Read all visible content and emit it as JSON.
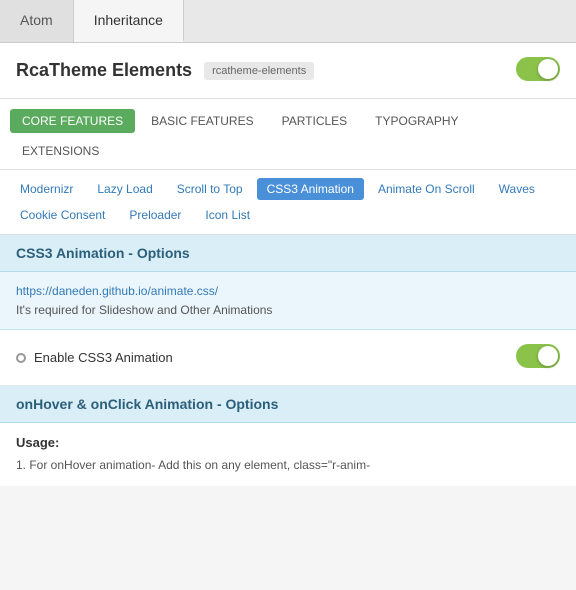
{
  "topTabs": [
    {
      "label": "Atom",
      "active": false
    },
    {
      "label": "Inheritance",
      "active": true
    }
  ],
  "header": {
    "title": "RcaTheme Elements",
    "badge": "rcatheme-elements",
    "toggleOn": true
  },
  "featureTabs": [
    {
      "label": "CORE FEATURES",
      "active": true
    },
    {
      "label": "BASIC FEATURES",
      "active": false
    },
    {
      "label": "PARTICLES",
      "active": false
    },
    {
      "label": "TYPOGRAPHY",
      "active": false
    }
  ],
  "extensionsTab": "EXTENSIONS",
  "subNav": [
    {
      "label": "Modernizr",
      "active": false
    },
    {
      "label": "Lazy Load",
      "active": false
    },
    {
      "label": "Scroll to Top",
      "active": false
    },
    {
      "label": "CSS3 Animation",
      "active": true
    },
    {
      "label": "Animate On Scroll",
      "active": false
    },
    {
      "label": "Waves",
      "active": false
    },
    {
      "label": "Cookie Consent",
      "active": false
    },
    {
      "label": "Preloader",
      "active": false
    },
    {
      "label": "Icon List",
      "active": false
    }
  ],
  "section1": {
    "title": "CSS3 Animation - Options"
  },
  "infoBox": {
    "link": "https://daneden.github.io/animate.css/",
    "text": "It's required for Slideshow and Other Animations"
  },
  "enableToggle": {
    "radioLabel": "Enable CSS3 Animation",
    "on": true
  },
  "section2": {
    "title": "onHover & onClick Animation - Options"
  },
  "usageBox": {
    "title": "Usage:",
    "text": "1. For onHover animation- Add this on any element, class=\"r-anim-"
  }
}
